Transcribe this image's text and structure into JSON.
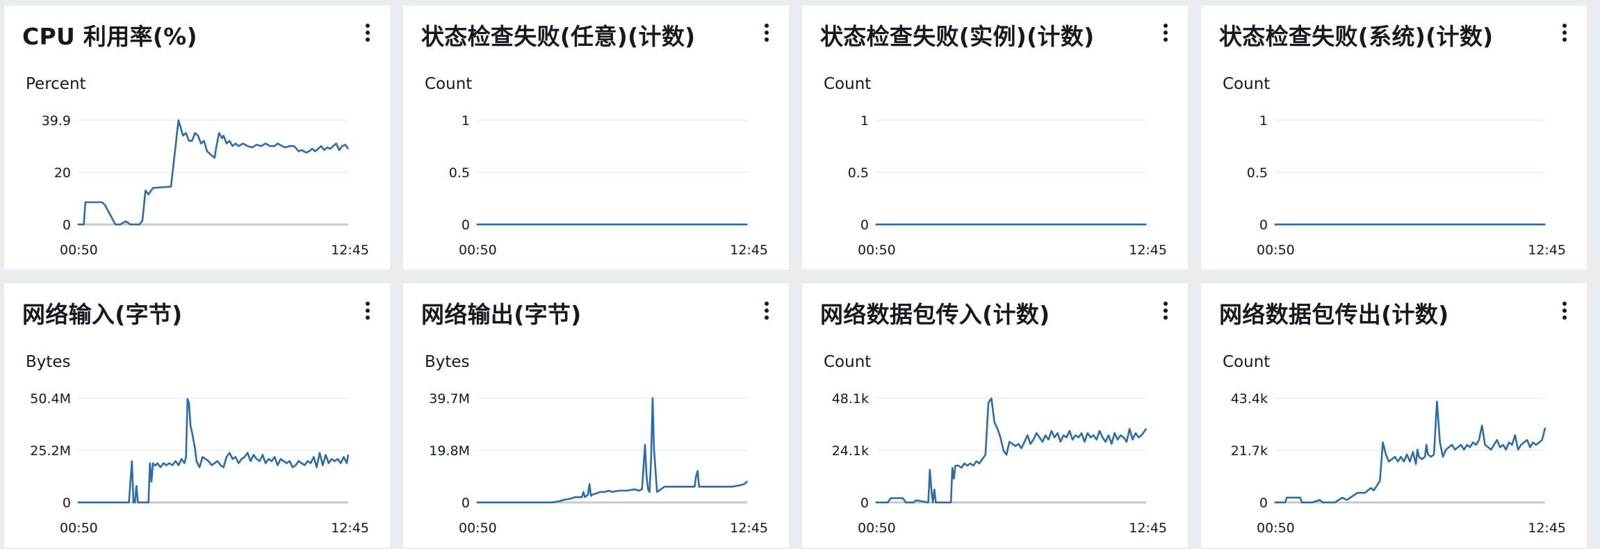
{
  "colors": {
    "line": "#2e6ca8",
    "grid": "#e9ebed",
    "axis": "#c8c9cc",
    "background": "#eaeded"
  },
  "panels": [
    {
      "title": "CPU 利用率(%)",
      "unit": "Percent",
      "menu_icon": "vertical-ellipsis-icon",
      "chart_data": {
        "type": "line",
        "xlabel": "",
        "ylabel": "Percent",
        "ylim": [
          0,
          39.9
        ],
        "y_ticks": [
          "0",
          "20",
          "39.9"
        ],
        "x_ticks": [
          "00:50",
          "12:45"
        ],
        "x": [
          0,
          4,
          5,
          16,
          18,
          25,
          28,
          32,
          35,
          41,
          43,
          45,
          47,
          50,
          62,
          67,
          70,
          72,
          74,
          76,
          78,
          80,
          82,
          84,
          86,
          88,
          89,
          91,
          92,
          94,
          96,
          97,
          99,
          101,
          103,
          105,
          107,
          110,
          113,
          116,
          119,
          122,
          125,
          128,
          131,
          133,
          136,
          138,
          141,
          144,
          147,
          149,
          152,
          154,
          156,
          158,
          160,
          162,
          164,
          166,
          168,
          170,
          172,
          174,
          176,
          178,
          180
        ],
        "y": [
          0,
          0,
          8.5,
          8.5,
          7.5,
          0,
          0,
          1.2,
          0,
          0,
          1.5,
          13,
          11.5,
          14,
          14.5,
          39.9,
          34,
          35,
          32,
          32,
          35,
          34,
          31,
          32,
          28,
          27,
          26.5,
          25.5,
          29,
          35,
          33,
          34,
          31,
          32,
          30,
          31,
          30,
          31,
          30,
          29.5,
          30.5,
          30,
          31,
          30,
          30,
          31,
          30,
          29.5,
          30,
          30,
          28,
          28.5,
          27.5,
          28,
          29,
          28,
          29,
          30,
          28.5,
          29.5,
          29,
          30,
          31,
          28.5,
          30,
          30.5,
          29
        ]
      }
    },
    {
      "title": "状态检查失败(任意)(计数)",
      "unit": "Count",
      "menu_icon": "vertical-ellipsis-icon",
      "chart_data": {
        "type": "line",
        "xlabel": "",
        "ylabel": "Count",
        "ylim": [
          0,
          1
        ],
        "y_ticks": [
          "0",
          "0.5",
          "1"
        ],
        "x_ticks": [
          "00:50",
          "12:45"
        ],
        "x": [
          0,
          180
        ],
        "y": [
          0,
          0
        ]
      }
    },
    {
      "title": "状态检查失败(实例)(计数)",
      "unit": "Count",
      "menu_icon": "vertical-ellipsis-icon",
      "chart_data": {
        "type": "line",
        "xlabel": "",
        "ylabel": "Count",
        "ylim": [
          0,
          1
        ],
        "y_ticks": [
          "0",
          "0.5",
          "1"
        ],
        "x_ticks": [
          "00:50",
          "12:45"
        ],
        "x": [
          0,
          180
        ],
        "y": [
          0,
          0
        ]
      }
    },
    {
      "title": "状态检查失败(系统)(计数)",
      "unit": "Count",
      "menu_icon": "vertical-ellipsis-icon",
      "chart_data": {
        "type": "line",
        "xlabel": "",
        "ylabel": "Count",
        "ylim": [
          0,
          1
        ],
        "y_ticks": [
          "0",
          "0.5",
          "1"
        ],
        "x_ticks": [
          "00:50",
          "12:45"
        ],
        "x": [
          0,
          180
        ],
        "y": [
          0,
          0
        ]
      }
    },
    {
      "title": "网络输入(字节)",
      "unit": "Bytes",
      "menu_icon": "vertical-ellipsis-icon",
      "chart_data": {
        "type": "line",
        "xlabel": "",
        "ylabel": "Bytes (M)",
        "ylim": [
          0,
          50.4
        ],
        "y_ticks": [
          "0",
          "25.2M",
          "50.4M"
        ],
        "x_ticks": [
          "00:50",
          "12:45"
        ],
        "x": [
          0,
          34,
          36,
          37,
          38,
          39,
          40,
          41,
          47,
          48,
          49,
          50,
          51,
          52,
          53,
          55,
          57,
          59,
          61,
          63,
          65,
          67,
          69,
          71,
          72,
          73,
          74,
          75,
          76,
          77,
          78,
          79,
          81,
          83,
          85,
          87,
          89,
          91,
          93,
          95,
          97,
          99,
          101,
          103,
          105,
          107,
          109,
          111,
          113,
          115,
          117,
          119,
          121,
          123,
          125,
          127,
          129,
          131,
          133,
          135,
          137,
          139,
          141,
          143,
          145,
          147,
          149,
          151,
          153,
          155,
          157,
          159,
          161,
          163,
          165,
          167,
          169,
          171,
          173,
          175,
          177,
          179,
          180
        ],
        "y": [
          0,
          0,
          20,
          0,
          0,
          8,
          0,
          0,
          0,
          19,
          10,
          19,
          18,
          18,
          19,
          17,
          19,
          18,
          19,
          18,
          20,
          18,
          21,
          19,
          22,
          50,
          48,
          37,
          34,
          30,
          26,
          20,
          17,
          22,
          21,
          20,
          18,
          19,
          20,
          18,
          17,
          22,
          24,
          21,
          22,
          19,
          21,
          22,
          24,
          20,
          23,
          21,
          20,
          23,
          19,
          21,
          20,
          22,
          18,
          21,
          20,
          19,
          20,
          17,
          18,
          20,
          19,
          18,
          20,
          19,
          22,
          17,
          24,
          18,
          23,
          19,
          21,
          20,
          21,
          19,
          22,
          19,
          23
        ]
      }
    },
    {
      "title": "网络输出(字节)",
      "unit": "Bytes",
      "menu_icon": "vertical-ellipsis-icon",
      "chart_data": {
        "type": "line",
        "xlabel": "",
        "ylabel": "Bytes (M)",
        "ylim": [
          0,
          39.7
        ],
        "y_ticks": [
          "0",
          "19.8M",
          "39.7M"
        ],
        "x_ticks": [
          "00:50",
          "12:45"
        ],
        "x": [
          0,
          50,
          55,
          58,
          60,
          63,
          65,
          70,
          71,
          72,
          73,
          74,
          75,
          76,
          77,
          80,
          82,
          85,
          88,
          90,
          95,
          100,
          105,
          108,
          110,
          112,
          113,
          114,
          115,
          116,
          117,
          118,
          120,
          125,
          130,
          135,
          140,
          145,
          146,
          147,
          148,
          150,
          155,
          160,
          165,
          170,
          175,
          178,
          180
        ],
        "y": [
          0,
          0,
          0.5,
          1,
          1.2,
          1.5,
          2,
          2,
          4,
          2,
          2.5,
          3,
          7,
          2.5,
          3,
          3.5,
          4,
          4,
          4.5,
          4,
          4.5,
          4.5,
          5,
          4.5,
          5,
          22,
          10,
          5,
          4,
          16,
          39.7,
          20,
          4,
          6,
          6,
          6,
          6,
          6,
          10,
          12,
          6,
          6,
          6,
          6,
          6,
          6,
          6.5,
          7,
          8
        ]
      }
    },
    {
      "title": "网络数据包传入(计数)",
      "unit": "Count",
      "menu_icon": "vertical-ellipsis-icon",
      "chart_data": {
        "type": "line",
        "xlabel": "",
        "ylabel": "Count (k)",
        "ylim": [
          0,
          48.1
        ],
        "y_ticks": [
          "0",
          "24.1k",
          "48.1k"
        ],
        "x_ticks": [
          "00:50",
          "12:45"
        ],
        "x": [
          0,
          8,
          10,
          18,
          20,
          25,
          27,
          35,
          36,
          37,
          38,
          39,
          40,
          41,
          50,
          51,
          52,
          53,
          55,
          57,
          59,
          61,
          63,
          65,
          67,
          69,
          71,
          73,
          75,
          77,
          79,
          81,
          83,
          85,
          87,
          89,
          91,
          93,
          95,
          97,
          99,
          101,
          103,
          105,
          107,
          109,
          111,
          113,
          115,
          117,
          119,
          121,
          123,
          125,
          127,
          129,
          131,
          133,
          135,
          137,
          139,
          141,
          143,
          145,
          147,
          149,
          151,
          153,
          155,
          157,
          159,
          161,
          163,
          165,
          167,
          169,
          171,
          173,
          175,
          177,
          179,
          180
        ],
        "y": [
          0,
          0,
          2,
          2,
          0,
          0,
          1,
          0,
          15,
          6,
          0,
          6,
          0,
          0,
          0,
          16,
          11,
          17,
          17,
          16,
          18,
          17,
          18,
          17,
          19,
          18,
          20,
          22,
          46,
          48,
          37,
          34,
          30,
          24,
          22,
          28,
          27,
          26,
          27,
          25,
          28,
          31,
          27,
          29,
          32,
          30,
          28,
          31,
          29,
          33,
          30,
          32,
          28,
          31,
          30,
          33,
          29,
          31,
          30,
          32,
          28,
          32,
          30,
          31,
          29,
          33,
          30,
          28,
          31,
          27,
          32,
          29,
          31,
          30,
          28,
          34,
          29,
          32,
          30,
          31,
          33,
          34
        ]
      }
    },
    {
      "title": "网络数据包传出(计数)",
      "unit": "Count",
      "menu_icon": "vertical-ellipsis-icon",
      "chart_data": {
        "type": "line",
        "xlabel": "",
        "ylabel": "Count (k)",
        "ylim": [
          0,
          43.4
        ],
        "y_ticks": [
          "0",
          "21.7k",
          "43.4k"
        ],
        "x_ticks": [
          "00:50",
          "12:45"
        ],
        "x": [
          0,
          7,
          8,
          15,
          17,
          18,
          25,
          30,
          32,
          40,
          45,
          48,
          55,
          60,
          62,
          64,
          66,
          68,
          70,
          72,
          74,
          76,
          78,
          80,
          82,
          84,
          86,
          88,
          90,
          92,
          94,
          95,
          96,
          98,
          100,
          101,
          102,
          104,
          106,
          108,
          110,
          112,
          114,
          116,
          118,
          120,
          122,
          124,
          126,
          128,
          130,
          132,
          134,
          136,
          138,
          140,
          142,
          144,
          146,
          148,
          150,
          152,
          154,
          156,
          158,
          160,
          162,
          164,
          166,
          168,
          170,
          172,
          174,
          176,
          178,
          180
        ],
        "y": [
          0,
          0,
          2,
          2,
          2,
          0,
          0,
          1,
          0,
          0,
          2,
          1,
          4,
          4,
          5,
          6,
          5,
          7,
          9,
          25,
          20,
          17,
          18,
          19,
          17,
          19,
          17,
          20,
          17,
          21,
          16,
          22,
          19,
          18,
          19,
          24,
          20,
          19,
          20,
          42,
          25,
          19,
          22,
          23,
          24,
          22,
          23,
          24,
          22,
          24,
          23,
          25,
          24,
          26,
          32,
          24,
          23,
          22,
          24,
          26,
          23,
          24,
          22,
          25,
          24,
          28,
          22,
          24,
          25,
          26,
          23,
          25,
          24,
          25,
          26,
          31
        ]
      }
    }
  ]
}
